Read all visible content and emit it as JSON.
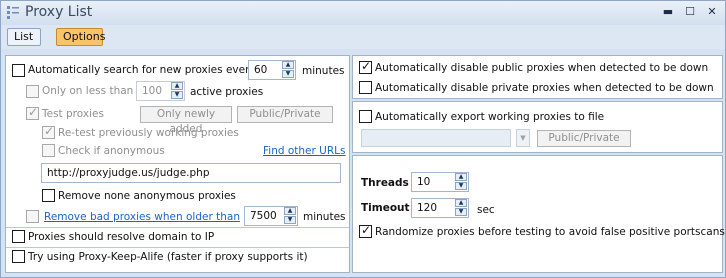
{
  "window": {
    "title": "Proxy List",
    "controls": {
      "minimize": "▬",
      "maximize": "☐",
      "close": "✕"
    }
  },
  "toolbar": {
    "tabs": [
      {
        "label": "List"
      },
      {
        "label": "Options"
      }
    ]
  },
  "left": {
    "auto_search": {
      "label": "Automatically search for new proxies every",
      "value": "60",
      "unit": "minutes"
    },
    "only_less_than": {
      "label": "Only on less than",
      "value": "100",
      "unit": "active proxies"
    },
    "test_proxies": {
      "label": "Test proxies",
      "btn_only_new": "Only newly added",
      "btn_public_private": "Public/Private"
    },
    "retest": {
      "label": "Re-test previously working proxies"
    },
    "check_anonymous": {
      "label": "Check if anonymous",
      "link": "Find other URLs"
    },
    "judge_url": "http://proxyjudge.us/judge.php",
    "remove_non_anon": {
      "label": "Remove none anonymous proxies"
    },
    "remove_bad": {
      "label": "Remove bad proxies when older than",
      "value": "7500",
      "unit": "minutes"
    },
    "resolve_domain": {
      "label": "Proxies should resolve domain to IP"
    },
    "keep_alive": {
      "label": "Try using Proxy-Keep-Alife (faster if proxy supports it)"
    }
  },
  "right": {
    "disable_public": {
      "label": "Automatically disable public proxies when detected to be down"
    },
    "disable_private": {
      "label": "Automatically disable private proxies when detected to be down"
    },
    "export": {
      "label": "Automatically export working proxies to file",
      "btn_public_private": "Public/Private"
    },
    "threads": {
      "label": "Threads",
      "value": "10"
    },
    "timeout": {
      "label": "Timeout",
      "value": "120",
      "unit": "sec"
    },
    "randomize": {
      "label": "Randomize proxies before testing to avoid false positive portscans"
    }
  },
  "icons": {
    "check": "✓",
    "arrow_up": "▲",
    "arrow_down": "▼"
  }
}
